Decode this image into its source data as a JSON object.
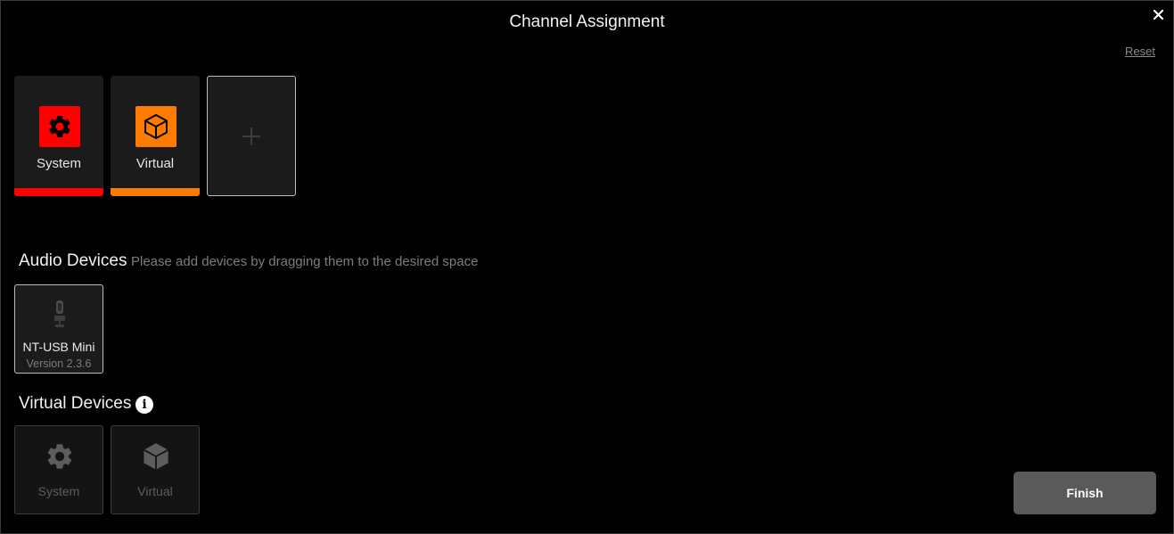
{
  "window": {
    "title": "Channel Assignment",
    "reset_label": "Reset"
  },
  "channels": [
    {
      "label": "System",
      "icon": "gear-icon",
      "color": "#ff0000"
    },
    {
      "label": "Virtual",
      "icon": "cube-icon",
      "color": "#ff7b00"
    }
  ],
  "add_channel": {
    "icon": "plus-icon"
  },
  "audio_devices": {
    "title": "Audio Devices",
    "hint": "Please add devices by dragging them to the desired space",
    "items": [
      {
        "name": "NT-USB Mini",
        "version": "Version 2.3.6",
        "icon": "microphone-icon"
      }
    ]
  },
  "virtual_devices": {
    "title": "Virtual Devices",
    "info_icon": "info-icon",
    "items": [
      {
        "label": "System",
        "icon": "gear-icon"
      },
      {
        "label": "Virtual",
        "icon": "cube-icon"
      }
    ]
  },
  "finish_label": "Finish",
  "colors": {
    "background": "#000000",
    "tile": "#1b1b1b",
    "system_accent": "#ff0000",
    "virtual_accent": "#ff7b00",
    "button": "#5a5a5a"
  }
}
